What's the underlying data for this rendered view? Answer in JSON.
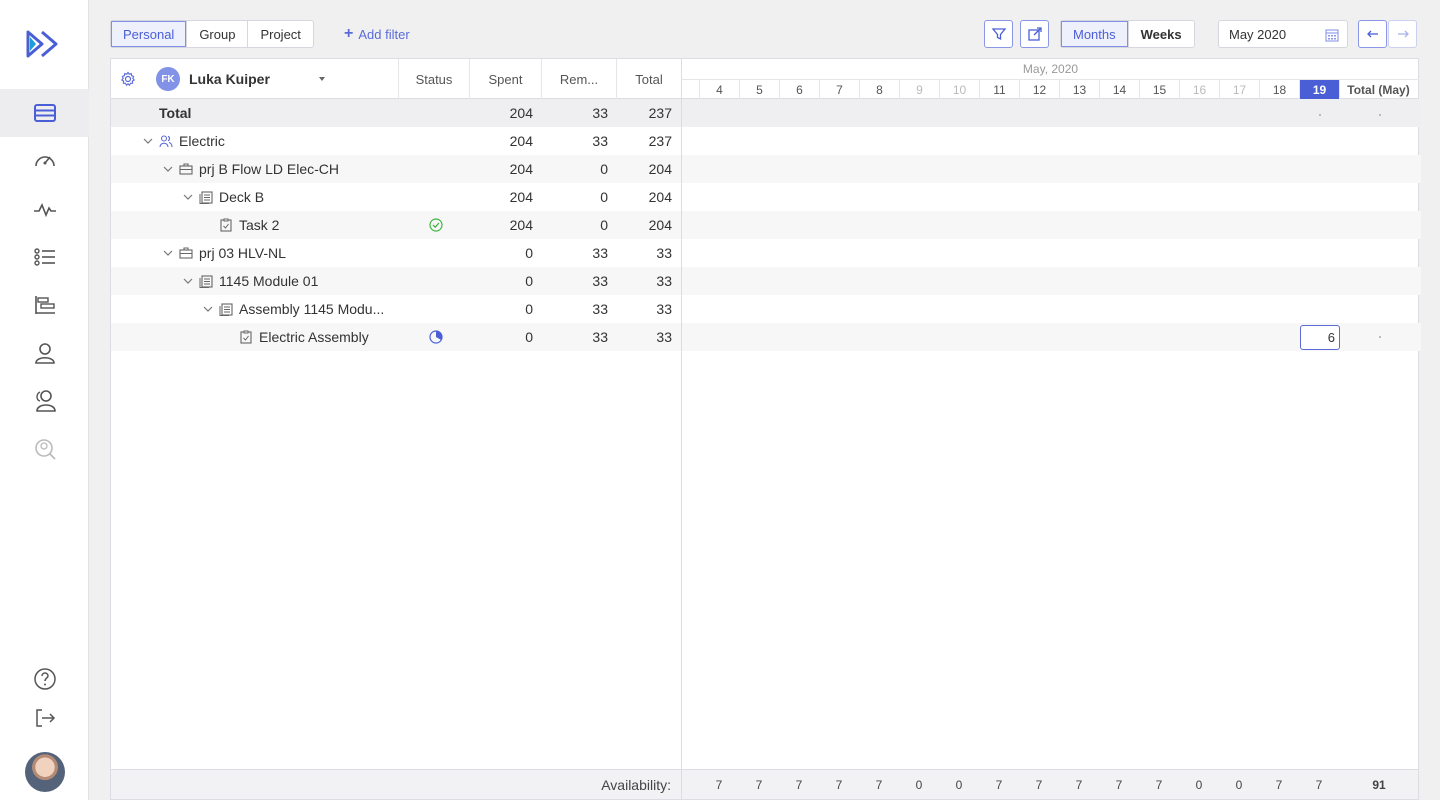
{
  "nav": {
    "items": [
      "timesheet",
      "dashboard",
      "activity",
      "tasks-list",
      "gantt",
      "user",
      "users",
      "search-reports"
    ],
    "bottom": [
      "help",
      "logout"
    ]
  },
  "toolbar": {
    "view_modes": [
      "Personal",
      "Group",
      "Project"
    ],
    "selected_view": "Personal",
    "add_filter_label": "Add filter",
    "period_modes": [
      "Months",
      "Weeks"
    ],
    "selected_period": "Months",
    "date_value": "May 2020"
  },
  "table": {
    "user_initials": "FK",
    "user_name": "Luka Kuiper",
    "columns": {
      "status": "Status",
      "spent": "Spent",
      "remaining": "Rem...",
      "total": "Total"
    },
    "rows": [
      {
        "name": "Total",
        "spent": "204",
        "rem": "33",
        "total": "237"
      },
      {
        "name": "Electric",
        "spent": "204",
        "rem": "33",
        "total": "237"
      },
      {
        "name": "prj B Flow LD Elec-CH",
        "spent": "204",
        "rem": "0",
        "total": "204"
      },
      {
        "name": "Deck B",
        "spent": "204",
        "rem": "0",
        "total": "204"
      },
      {
        "name": "Task 2",
        "spent": "204",
        "rem": "0",
        "total": "204"
      },
      {
        "name": "prj 03 HLV-NL",
        "spent": "0",
        "rem": "33",
        "total": "33"
      },
      {
        "name": "1145 Module 01",
        "spent": "0",
        "rem": "33",
        "total": "33"
      },
      {
        "name": "Assembly 1145 Modu...",
        "spent": "0",
        "rem": "33",
        "total": "33"
      },
      {
        "name": "Electric Assembly",
        "spent": "0",
        "rem": "33",
        "total": "33"
      }
    ]
  },
  "grid": {
    "month_label": "May, 2020",
    "days": [
      "4",
      "5",
      "6",
      "7",
      "8",
      "9",
      "10",
      "11",
      "12",
      "13",
      "14",
      "15",
      "16",
      "17",
      "18",
      "19"
    ],
    "total_label": "Total (May)",
    "edit_value": "6"
  },
  "footer": {
    "availability_label": "Availability:",
    "values": [
      "7",
      "7",
      "7",
      "7",
      "7",
      "0",
      "0",
      "7",
      "7",
      "7",
      "7",
      "7",
      "0",
      "0",
      "7",
      "7"
    ],
    "total": "91"
  },
  "colors": {
    "accent": "#4a5fd6",
    "success": "#3fb43f"
  }
}
